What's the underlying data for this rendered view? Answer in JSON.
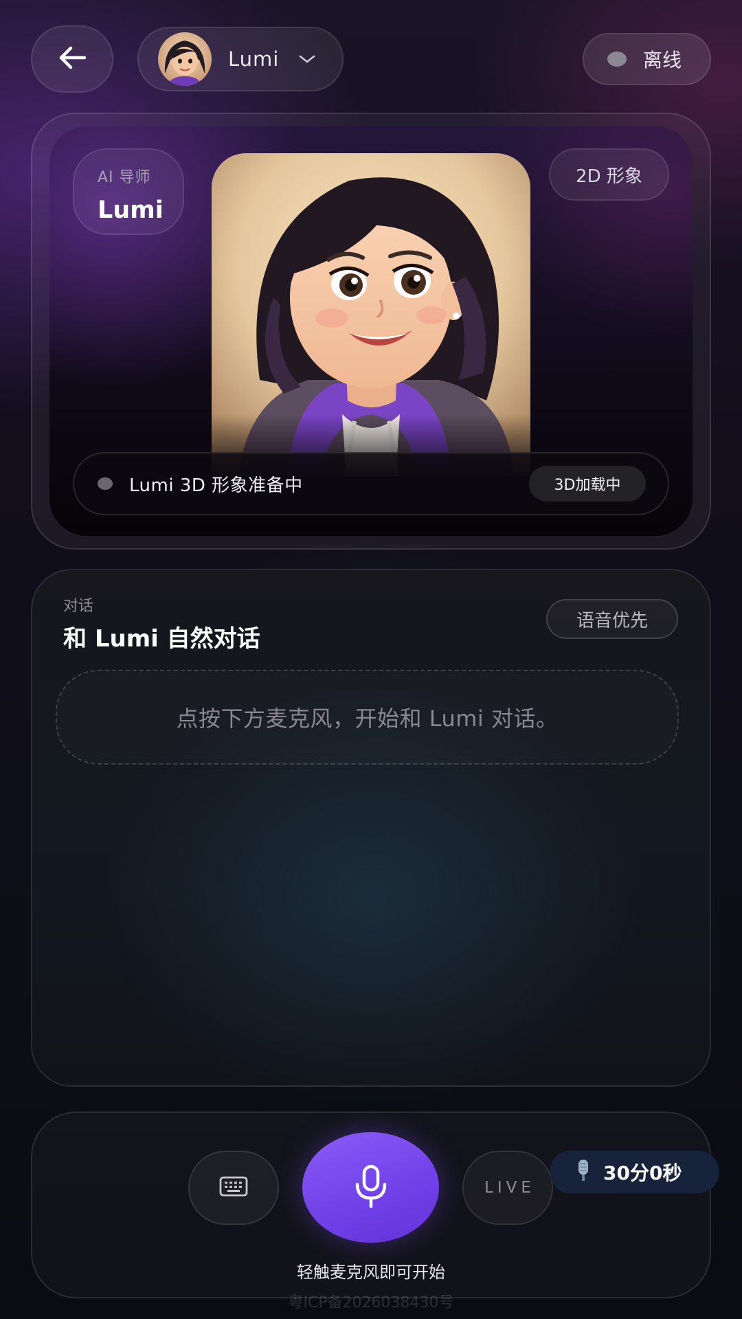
{
  "header": {
    "agent_name": "Lumi",
    "status_label": "离线"
  },
  "stage": {
    "tutor_kicker": "AI 导师",
    "tutor_name": "Lumi",
    "mode_label": "2D 形象",
    "loading_text": "Lumi 3D 形象准备中",
    "loading_badge": "3D加载中"
  },
  "chat": {
    "kicker": "对话",
    "title": "和 Lumi 自然对话",
    "voice_label": "语音优先",
    "empty_hint": "点按下方麦克风，开始和 Lumi 对话。"
  },
  "controls": {
    "live_label": "LIVE",
    "timer_label": "30分0秒",
    "mic_hint": "轻触麦克风即可开始"
  },
  "footer": {
    "icp": "粤ICP备2026038430号"
  },
  "colors": {
    "accent": "#7c4dff",
    "status_offline": "#8b8794",
    "timer_bg": "#17233a"
  },
  "icons": [
    "back-arrow-icon",
    "chevron-down-icon",
    "keyboard-icon",
    "microphone-icon",
    "microphone-emoji-icon"
  ]
}
